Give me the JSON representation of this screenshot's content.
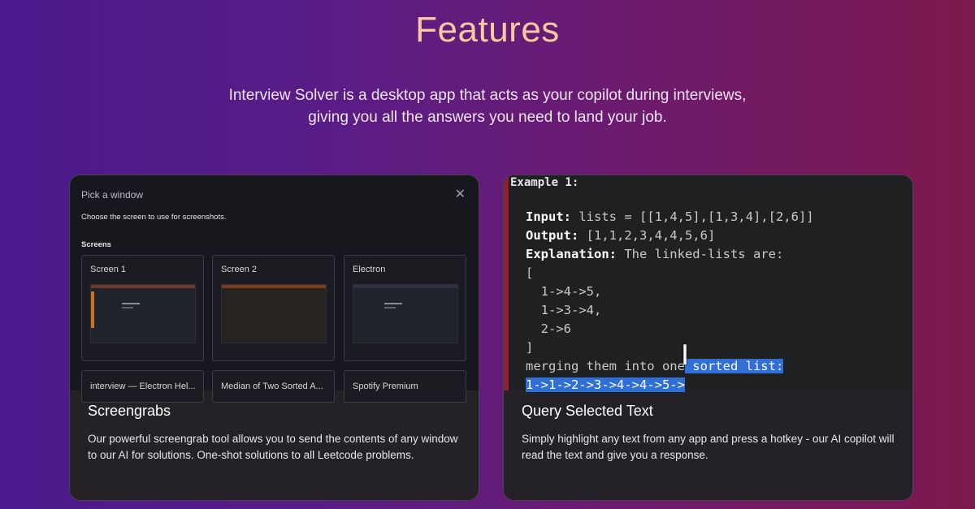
{
  "header": {
    "title": "Features",
    "subtitle_line1": "Interview Solver is a desktop app that acts as your copilot during interviews,",
    "subtitle_line2": "giving you all the answers you need to land your job."
  },
  "cards": [
    {
      "title": "Screengrabs",
      "description": "Our powerful screengrab tool allows you to send the contents of any window to our AI for solutions. One-shot solutions to all Leetcode problems.",
      "media": {
        "dialog_title": "Pick a window",
        "close_glyph": "✕",
        "dialog_subtitle": "Choose the screen to use for screenshots.",
        "section_label": "Screens",
        "tiles": [
          {
            "label": "Screen 1"
          },
          {
            "label": "Screen 2"
          },
          {
            "label": "Electron"
          },
          {
            "label": "interview — Electron Hel..."
          },
          {
            "label": "Median of Two Sorted A..."
          },
          {
            "label": "Spotify Premium"
          }
        ]
      }
    },
    {
      "title": "Query Selected Text",
      "description": "Simply highlight any text from any app and press a hotkey - our AI copilot will read the text and give you a response.",
      "media": {
        "example_title": "Example 1:",
        "input_key": "Input:",
        "input_val": " lists = [[1,4,5],[1,3,4],[2,6]]",
        "output_key": "Output:",
        "output_val": " [1,1,2,3,4,4,5,6]",
        "explanation_key": "Explanation:",
        "explanation_val": " The linked-lists are:",
        "open_bracket": "[",
        "list1": "  1->4->5,",
        "list2": "  1->3->4,",
        "list3": "  2->6",
        "close_bracket": "]",
        "merge_plain": "merging them into one",
        "merge_highlight": " sorted list:",
        "merged_highlight": "1->1->2->3->4->4->5->",
        "cursor_glyph": "I"
      }
    }
  ],
  "colors": {
    "title": "#fbc9a0",
    "card_bg": "#242226",
    "highlight": "#2f6fd6"
  }
}
